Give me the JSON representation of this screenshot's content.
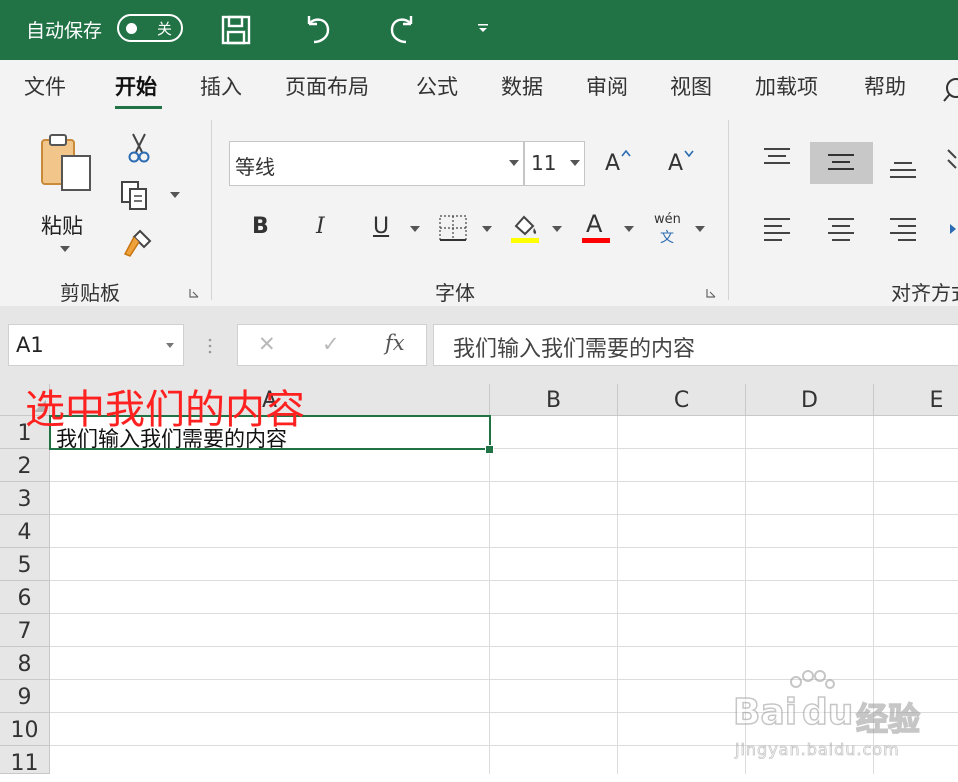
{
  "titlebar": {
    "autosave_label": "自动保存",
    "autosave_state": "关",
    "icons": [
      "save-icon",
      "undo-icon",
      "redo-icon",
      "customize-dropdown-icon"
    ],
    "color": "#217346"
  },
  "tabs": [
    {
      "label": "文件"
    },
    {
      "label": "开始",
      "active": true
    },
    {
      "label": "插入"
    },
    {
      "label": "页面布局"
    },
    {
      "label": "公式"
    },
    {
      "label": "数据"
    },
    {
      "label": "审阅"
    },
    {
      "label": "视图"
    },
    {
      "label": "加载项"
    },
    {
      "label": "帮助"
    }
  ],
  "ribbon": {
    "clipboard": {
      "paste_label": "粘贴",
      "group_label": "剪贴板"
    },
    "font": {
      "font_name": "等线",
      "font_size": "11",
      "grow_label": "A",
      "shrink_label": "A",
      "bold": "B",
      "italic": "I",
      "underline": "U",
      "font_color_glyph": "A",
      "phonetic_top": "wén",
      "phonetic_bottom": "文",
      "group_label": "字体",
      "highlight_color": "#ffff00",
      "font_color": "#ff0000"
    },
    "alignment": {
      "group_label": "对齐方式"
    }
  },
  "formula_bar": {
    "name_box": "A1",
    "cancel_glyph": "✕",
    "enter_glyph": "✓",
    "fx_label": "fx",
    "content": "我们输入我们需要的内容"
  },
  "sheet": {
    "columns": [
      "A",
      "B",
      "C",
      "D",
      "E"
    ],
    "rows": [
      "1",
      "2",
      "3",
      "4",
      "5",
      "6",
      "7",
      "8",
      "9",
      "10",
      "11"
    ],
    "cell_a1": "我们输入我们需要的内容",
    "selected_cell": "A1",
    "selection_color": "#217346"
  },
  "annotation": {
    "text": "选中我们的内容",
    "color": "#ff2020"
  },
  "watermark": {
    "line1": "Bai",
    "line2": "du",
    "line3": "经验",
    "url": "jingyan.baidu.com"
  }
}
